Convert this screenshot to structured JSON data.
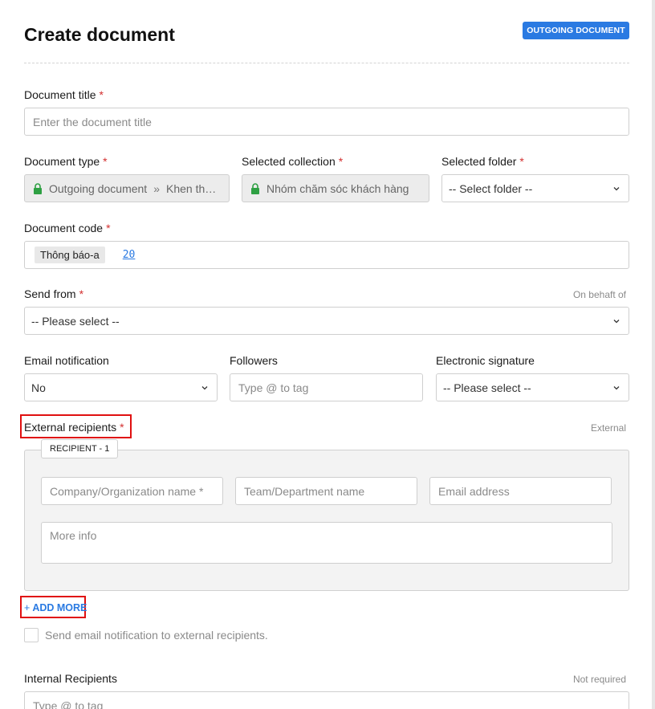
{
  "header": {
    "title": "Create document",
    "badge": "OUTGOING DOCUMENT"
  },
  "document_title": {
    "label": "Document title",
    "required": "*",
    "placeholder": "Enter the document title"
  },
  "document_type": {
    "label": "Document type",
    "required": "*",
    "value_part1": "Outgoing document",
    "separator": "»",
    "value_part2": "Khen thư..."
  },
  "selected_collection": {
    "label": "Selected collection",
    "required": "*",
    "value": "Nhóm chăm sóc khách hàng"
  },
  "selected_folder": {
    "label": "Selected folder",
    "required": "*",
    "value": "-- Select folder --"
  },
  "document_code": {
    "label": "Document code",
    "required": "*",
    "prefix": "Thông báo-a",
    "number": "20"
  },
  "send_from": {
    "label": "Send from",
    "required": "*",
    "hint": "On behaft of",
    "value": "-- Please select --"
  },
  "email_notification": {
    "label": "Email notification",
    "value": "No"
  },
  "followers": {
    "label": "Followers",
    "placeholder": "Type @ to tag"
  },
  "electronic_signature": {
    "label": "Electronic signature",
    "value": "-- Please select --"
  },
  "external_recipients": {
    "label": "External recipients",
    "required": "*",
    "hint": "External",
    "recipient_tag": "RECIPIENT - 1",
    "company_placeholder": "Company/Organization name *",
    "team_placeholder": "Team/Department name",
    "email_placeholder": "Email address",
    "more_info_placeholder": "More info",
    "add_more_plus": "+",
    "add_more": "ADD MORE",
    "notify_label": "Send email notification to external recipients."
  },
  "internal_recipients": {
    "label": "Internal Recipients",
    "hint": "Not required",
    "placeholder": "Type @ to tag"
  },
  "colors": {
    "accent": "#2a7ae2",
    "required": "#d32f2f",
    "highlight": "#e01010"
  }
}
